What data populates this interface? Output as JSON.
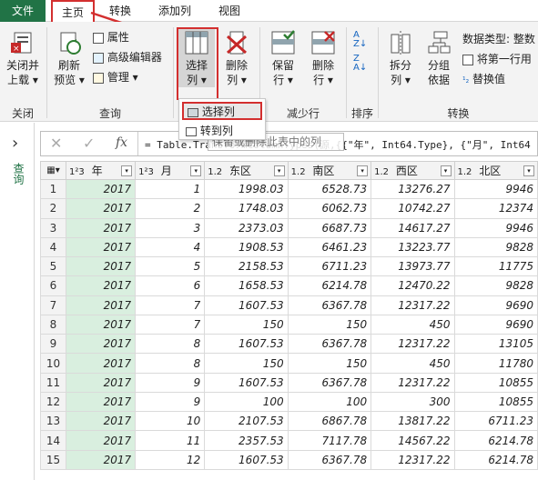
{
  "tabs": {
    "file": "文件",
    "home": "主页",
    "transform": "转换",
    "add_column": "添加列",
    "view": "视图"
  },
  "ribbon": {
    "close": {
      "line1": "关闭并",
      "line2": "上载",
      "arrow": "▾",
      "group": "关闭"
    },
    "refresh": {
      "line1": "刷新",
      "line2": "预览",
      "arrow": "▾"
    },
    "properties": "属性",
    "advanced_editor": "高级编辑器",
    "manage": "管理",
    "manage_arrow": "▾",
    "query_group": "查询",
    "choose_cols": {
      "line1": "选择",
      "line2": "列",
      "arrow": "▾"
    },
    "remove_cols": {
      "line1": "删除",
      "line2": "列",
      "arrow": "▾"
    },
    "keep_rows": {
      "line1": "保留",
      "line2": "行",
      "arrow": "▾"
    },
    "remove_rows": {
      "line1": "删除",
      "line2": "行",
      "arrow": "▾"
    },
    "reduce_rows_group": "减少行",
    "sort_group": "排序",
    "split_col": {
      "line1": "拆分",
      "line2": "列",
      "arrow": "▾"
    },
    "group_by": {
      "line1": "分组",
      "line2": "依据"
    },
    "data_type": "数据类型: 整数",
    "first_row_header": "将第一行用",
    "replace_values": "替换值",
    "transform_group": "转换"
  },
  "dropdown": {
    "choose_columns": "选择列",
    "goto_column": "转到列"
  },
  "tooltip": "保留或删除此表中的列",
  "sidebar": {
    "label": "查询",
    "expand": "›"
  },
  "formula": {
    "cancel": "✕",
    "confirm": "✓",
    "fx": "fx",
    "text": "= Table.TransformColumnTypes(源,{{\"年\", Int64.Type}, {\"月\", Int64"
  },
  "table": {
    "columns": [
      {
        "type": "1²3",
        "name": "年"
      },
      {
        "type": "1²3",
        "name": "月"
      },
      {
        "type": "1.2",
        "name": "东区"
      },
      {
        "type": "1.2",
        "name": "南区"
      },
      {
        "type": "1.2",
        "name": "西区"
      },
      {
        "type": "1.2",
        "name": "北区"
      }
    ],
    "rows": [
      [
        "1",
        "2017",
        "1",
        "1998.03",
        "6528.73",
        "13276.27",
        "9946"
      ],
      [
        "2",
        "2017",
        "2",
        "1748.03",
        "6062.73",
        "10742.27",
        "12374"
      ],
      [
        "3",
        "2017",
        "3",
        "2373.03",
        "6687.73",
        "14617.27",
        "9946"
      ],
      [
        "4",
        "2017",
        "4",
        "1908.53",
        "6461.23",
        "13223.77",
        "9828"
      ],
      [
        "5",
        "2017",
        "5",
        "2158.53",
        "6711.23",
        "13973.77",
        "11775"
      ],
      [
        "6",
        "2017",
        "6",
        "1658.53",
        "6214.78",
        "12470.22",
        "9828"
      ],
      [
        "7",
        "2017",
        "7",
        "1607.53",
        "6367.78",
        "12317.22",
        "9690"
      ],
      [
        "8",
        "2017",
        "7",
        "150",
        "150",
        "450",
        "9690"
      ],
      [
        "9",
        "2017",
        "8",
        "1607.53",
        "6367.78",
        "12317.22",
        "13105"
      ],
      [
        "10",
        "2017",
        "8",
        "150",
        "150",
        "450",
        "11780"
      ],
      [
        "11",
        "2017",
        "9",
        "1607.53",
        "6367.78",
        "12317.22",
        "10855"
      ],
      [
        "12",
        "2017",
        "9",
        "100",
        "100",
        "300",
        "10855"
      ],
      [
        "13",
        "2017",
        "10",
        "2107.53",
        "6867.78",
        "13817.22",
        "6711.23"
      ],
      [
        "14",
        "2017",
        "11",
        "2357.53",
        "7117.78",
        "14567.22",
        "6214.78"
      ],
      [
        "15",
        "2017",
        "12",
        "1607.53",
        "6367.78",
        "12317.22",
        "6214.78"
      ]
    ]
  },
  "colors": {
    "file_tab": "#217346",
    "highlight_red": "#d32f2f",
    "year_col": "#d9efdf"
  }
}
